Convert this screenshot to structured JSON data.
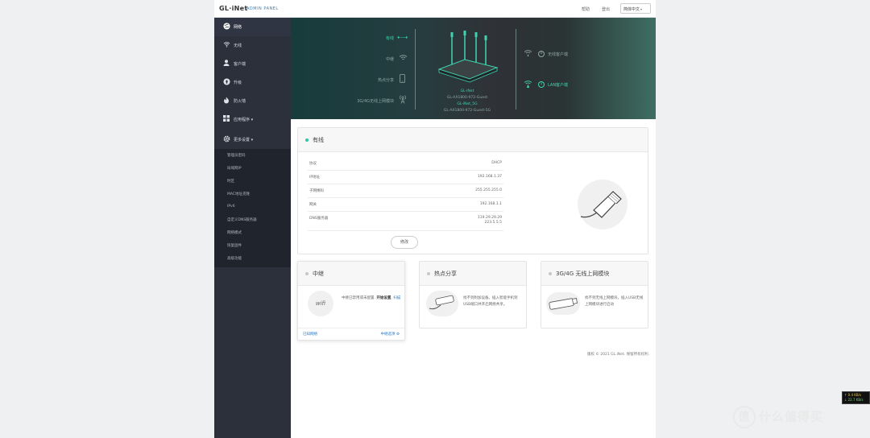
{
  "header": {
    "logo": "GL·iNet",
    "subtitle": "ADMIN PANEL",
    "help": "帮助",
    "logout": "登出",
    "language": "简体中文"
  },
  "sidebar": {
    "items": [
      {
        "label": "网络",
        "icon": "globe-icon"
      },
      {
        "label": "无线",
        "icon": "wifi-icon"
      },
      {
        "label": "客户端",
        "icon": "user-icon"
      },
      {
        "label": "升级",
        "icon": "upgrade-icon"
      },
      {
        "label": "防火墙",
        "icon": "firewall-icon"
      },
      {
        "label": "应用程序 ▾",
        "icon": "apps-icon"
      },
      {
        "label": "更多设置 ▾",
        "icon": "gear-icon"
      }
    ],
    "sub_items": [
      "管理员密码",
      "局域网IP",
      "时区",
      "MAC地址克隆",
      "IPv6",
      "自定义DNS服务器",
      "网络模式",
      "恢复固件",
      "高级功能"
    ]
  },
  "hero": {
    "left": [
      {
        "label": "有线",
        "active": true
      },
      {
        "label": "中继",
        "active": false
      },
      {
        "label": "热点分享",
        "active": false
      },
      {
        "label": "3G/4G无线上网模块",
        "active": false
      }
    ],
    "router_lines": [
      "GL-iNet",
      "GL-AX1800-972-Guest",
      "GL-iNet_5G",
      "GL-AX1800-972-Guest-5G"
    ],
    "right": [
      {
        "count": "0",
        "label": "无线客户端"
      },
      {
        "count": "1",
        "label": "LAN客户端"
      }
    ]
  },
  "wired": {
    "title": "有线",
    "rows": [
      {
        "key": "协议",
        "value": "DHCP"
      },
      {
        "key": "IP地址",
        "value": "192.168.1.37"
      },
      {
        "key": "子网掩码",
        "value": "255.255.255.0"
      },
      {
        "key": "网关",
        "value": "192.168.1.1"
      },
      {
        "key": "DNS服务器",
        "value": "119.29.29.29\n223.5.5.5"
      }
    ],
    "edit_label": "修改"
  },
  "repeater": {
    "title": "中继",
    "text": "中继已禁用或未配置.",
    "link1": "开始设置",
    "link2": "扫描",
    "known": "已知网络",
    "settings": "中继选项",
    "icon_text": "wifi"
  },
  "hotspot": {
    "title": "热点分享",
    "text": "找不到附加设备。插入智能手机到USB端口并开启网络共享。"
  },
  "modem": {
    "title": "3G/4G 无线上网模块",
    "text": "找不到无线上网模块，插入USB无线上网模块进行启动"
  },
  "footer": "版权 © 2021 GL.iNet. 保留所有权利.",
  "speed": [
    "↑ 0.4 KB/s",
    "↓ 22.7 KB/s"
  ],
  "watermark": "什么值得买",
  "colors": {
    "accent": "#2fc7a4",
    "sidebar": "#2b303b",
    "sidebar_sub": "#20242d"
  }
}
